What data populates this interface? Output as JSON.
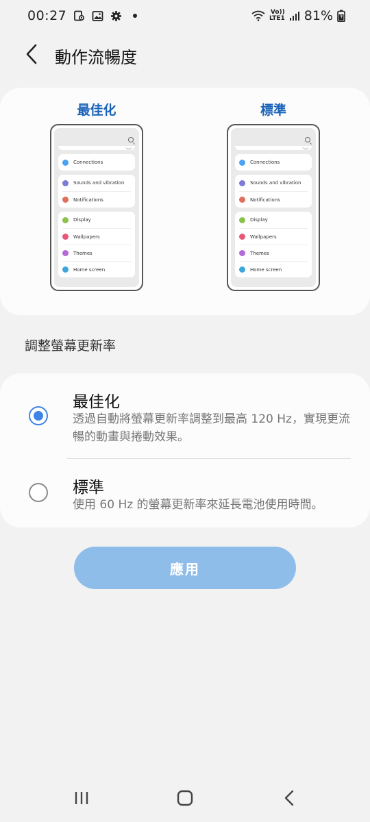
{
  "status_bar": {
    "time": "00:27",
    "network_top": "Vo))",
    "network_bottom": "LTE1",
    "battery": "81%"
  },
  "header": {
    "title": "動作流暢度"
  },
  "preview": {
    "optimized_label": "最佳化",
    "standard_label": "標準",
    "phone_groups": [
      [
        "Connections"
      ],
      [
        "Sounds and vibration",
        "Notifications"
      ],
      [
        "Display",
        "Wallpapers",
        "Themes",
        "Home screen"
      ]
    ],
    "phone_icon_colors": [
      "#4aa3f0",
      "#7b7bd8",
      "#e0705c",
      "#8bc34a",
      "#e8577a",
      "#b56bd6",
      "#3ea6d8"
    ]
  },
  "section": {
    "label": "調整螢幕更新率"
  },
  "options": [
    {
      "title": "最佳化",
      "desc": "透過自動將螢幕更新率調整到最高 120 Hz，實現更流暢的動畫與捲動效果。",
      "selected": true
    },
    {
      "title": "標準",
      "desc": "使用 60 Hz 的螢幕更新率來延長電池使用時間。",
      "selected": false
    }
  ],
  "apply_button": {
    "label": "應用"
  },
  "colors": {
    "accent": "#3e84e5",
    "label_blue": "#1a62b8",
    "apply_bg": "#8fbde9"
  }
}
